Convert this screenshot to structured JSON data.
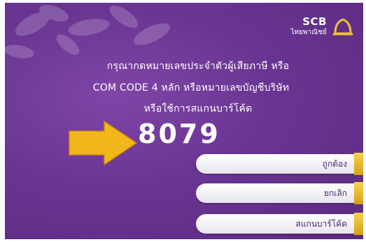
{
  "brand": {
    "name": "SCB",
    "subname": "ไทยพาณิชย์",
    "accent": "#6a3592",
    "button_tab_color": "#e0aa1d",
    "arrow_color": "#f2b81b"
  },
  "instructions": {
    "line1": "กรุณากดหมายเลขประจำตัวผู้เสียภาษี หรือ",
    "line2": "COM CODE 4 หลัก หรือหมายเลขบัญชีบริษัท",
    "line3": "หรือใช้การสแกนบาร์โค้ด"
  },
  "entered_code": "8079",
  "buttons": {
    "confirm": "ถูกต้อง",
    "cancel": "ยกเลิก",
    "scan": "สแกนบาร์โค้ด"
  },
  "icons": {
    "pointer": "arrow-right-icon",
    "logo": "scb-logo-icon"
  }
}
